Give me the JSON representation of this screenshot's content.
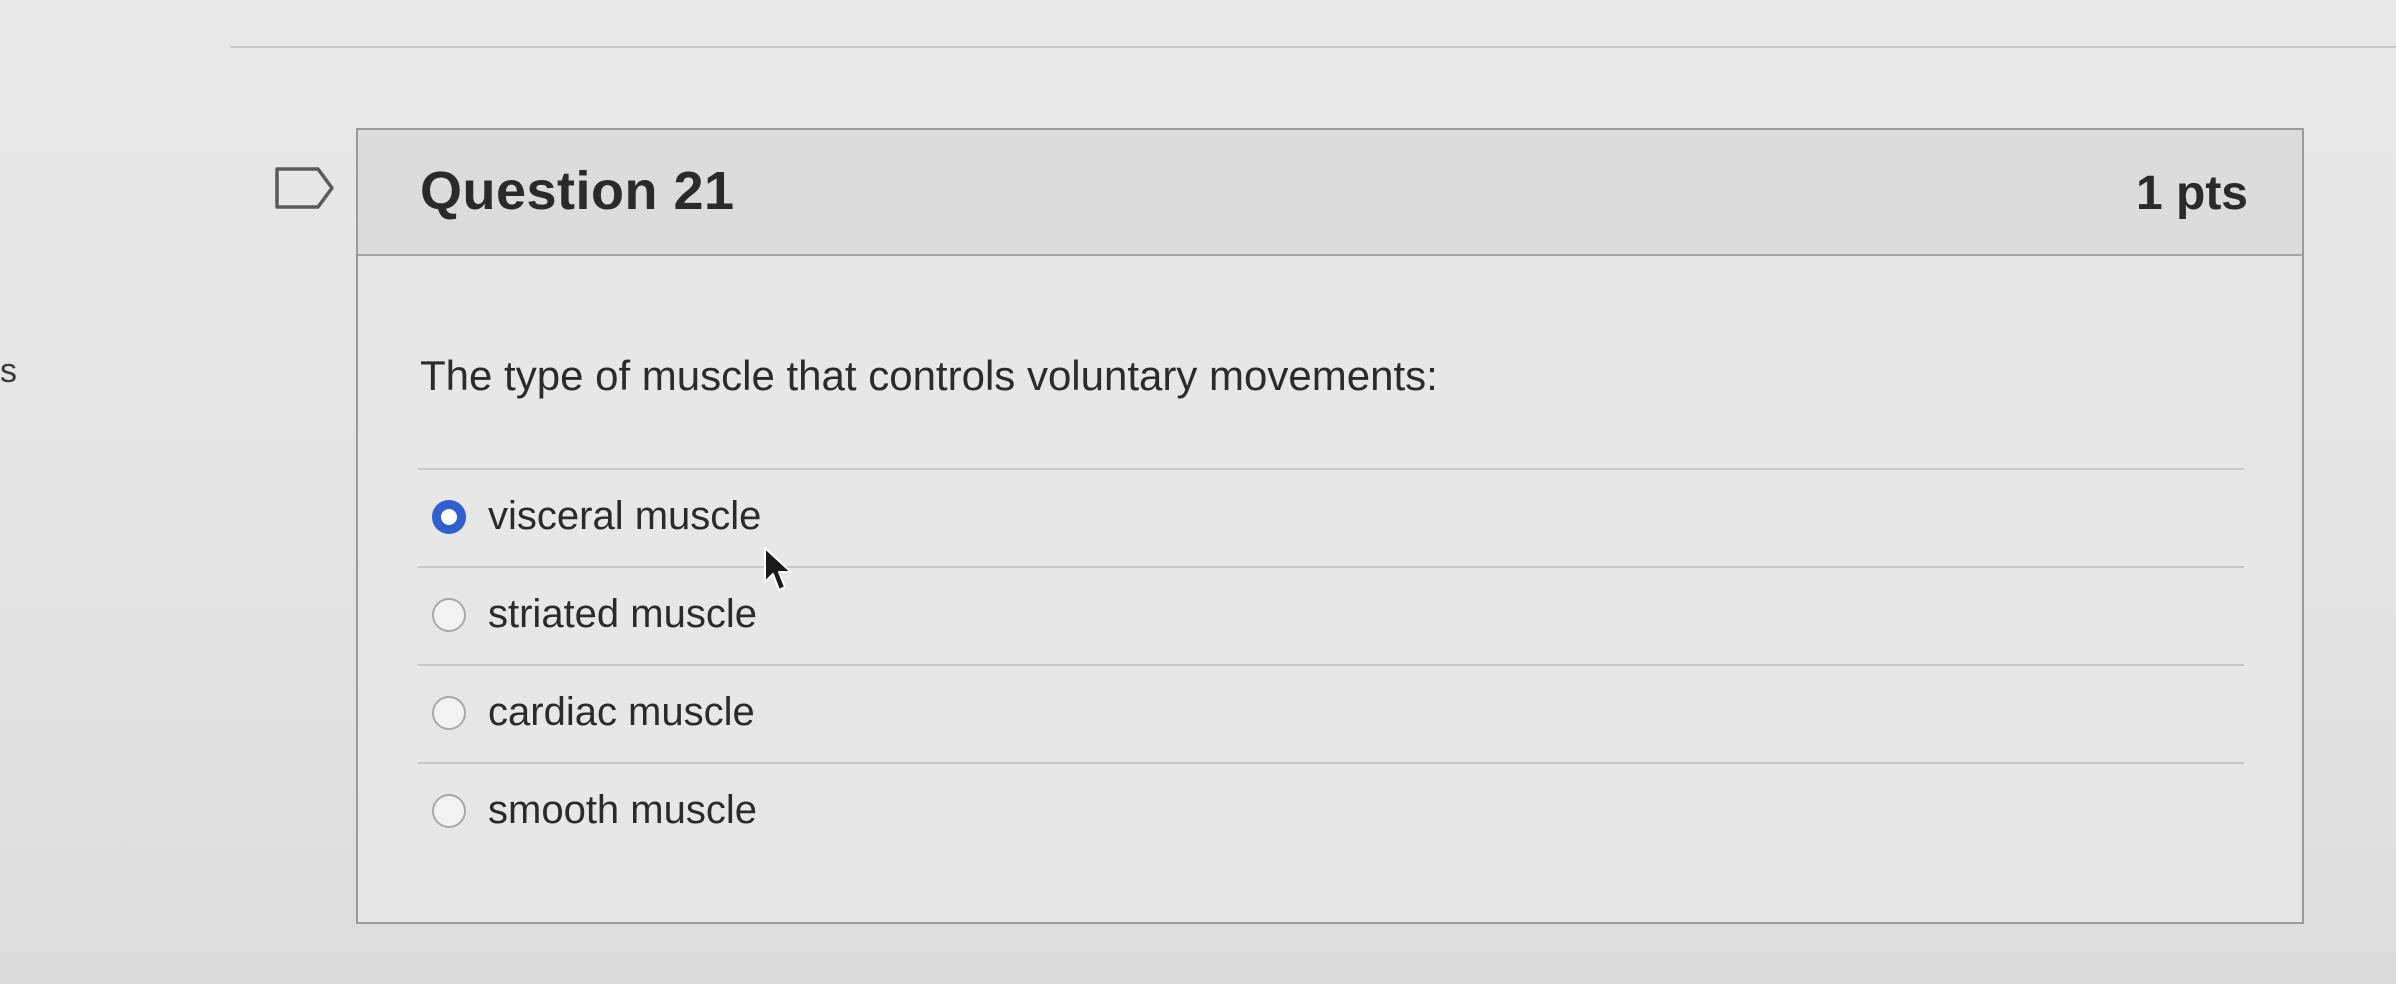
{
  "edge": {
    "letter": "s"
  },
  "question": {
    "title": "Question 21",
    "points": "1 pts",
    "text": "The type of muscle that controls voluntary movements:",
    "answers": [
      {
        "label": "visceral muscle",
        "selected": true
      },
      {
        "label": "striated muscle",
        "selected": false
      },
      {
        "label": "cardiac muscle",
        "selected": false
      },
      {
        "label": "smooth muscle",
        "selected": false
      }
    ]
  },
  "colors": {
    "radio_selected": "#2f5fd0",
    "header_bg": "#dcdcda",
    "text": "#2b2b2b"
  },
  "icons": {
    "flag": "flag-icon",
    "cursor": "mouse-pointer-icon"
  }
}
